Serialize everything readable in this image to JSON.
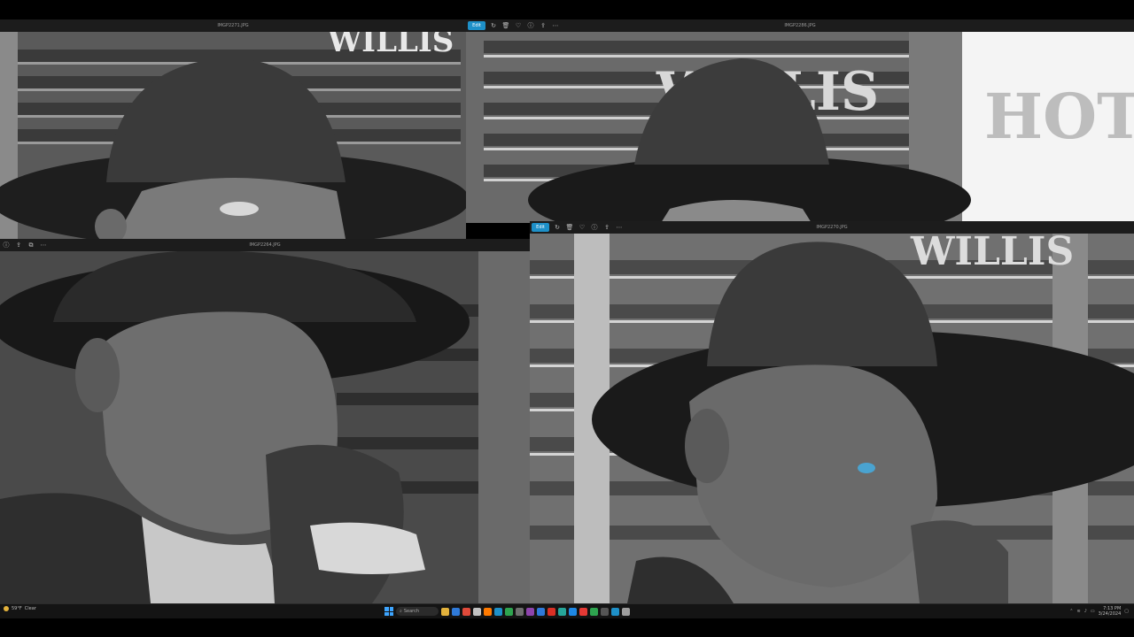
{
  "windows": [
    {
      "title": "IMGP2271.JPG",
      "edit_label": ""
    },
    {
      "title": "IMGP2286.JPG",
      "edit_label": "Edit"
    },
    {
      "title": "IMGP2264.JPG",
      "edit_label": ""
    },
    {
      "title": "IMGP2270.JPG",
      "edit_label": "Edit"
    }
  ],
  "photo_text": {
    "sign_willis": "WILLIS",
    "sign_hotel": "HOT"
  },
  "taskbar": {
    "weather_temp": "59°F",
    "weather_desc": "Clear",
    "search_placeholder": "Search",
    "time": "7:13 PM",
    "date": "3/24/2024",
    "apps": [
      "#e3b23c",
      "#2f7ad9",
      "#e04a3a",
      "#c2c2c2",
      "#ff7a00",
      "#1e90c8",
      "#2ea44f",
      "#6f6f6f",
      "#8e44ad",
      "#2f7ad9",
      "#d93025",
      "#26a69a",
      "#1e88e5",
      "#e53935",
      "#2ea44f",
      "#555555",
      "#1e90c8",
      "#9e9e9e"
    ]
  },
  "colors": {
    "accent": "#1e90c8",
    "titlebar": "#1c1c1c",
    "background": "#000000"
  }
}
